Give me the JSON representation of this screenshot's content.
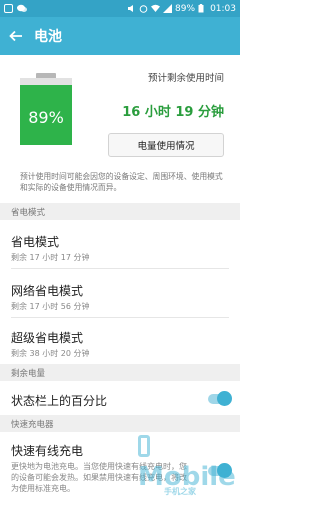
{
  "status_bar": {
    "time": "01:03",
    "battery": "89%"
  },
  "app_bar": {
    "title": "电池",
    "back_icon": "arrow-left-icon"
  },
  "battery_card": {
    "level_percent": 89,
    "level_text": "89%",
    "est_label": "预计剩余使用时间",
    "est_value": "16 小时 19 分钟",
    "usage_button": "电量使用情况",
    "note": "预计使用时间可能会因您的设备设定、周围环境、使用模式和实际的设备使用情况而异。",
    "fill_color": "#2eb34a"
  },
  "sections": {
    "power_saving_header": "省电模式",
    "remaining_header": "剩余电量",
    "fast_charge_header": "快速充电器"
  },
  "items": {
    "power_saving": {
      "title": "省电模式",
      "sub": "剩余 17 小时 17 分钟"
    },
    "network_saving": {
      "title": "网络省电模式",
      "sub": "剩余 17 小时 56 分钟"
    },
    "ultra_saving": {
      "title": "超级省电模式",
      "sub": "剩余 38 小时 20 分钟"
    },
    "percent_in_statusbar": {
      "title": "状态栏上的百分比",
      "enabled": true
    },
    "fast_wired": {
      "title": "快速有线充电",
      "sub": "更快地为电池充电。当您使用快速有线充电时，您的设备可能会发热。如果禁用快速有线充电，将改为使用标准充电。",
      "enabled": true
    }
  },
  "watermark": {
    "brand": "Mobile",
    "sub": "手机之家"
  },
  "colors": {
    "accent": "#3fb1d3",
    "green": "#2a9d3d"
  }
}
